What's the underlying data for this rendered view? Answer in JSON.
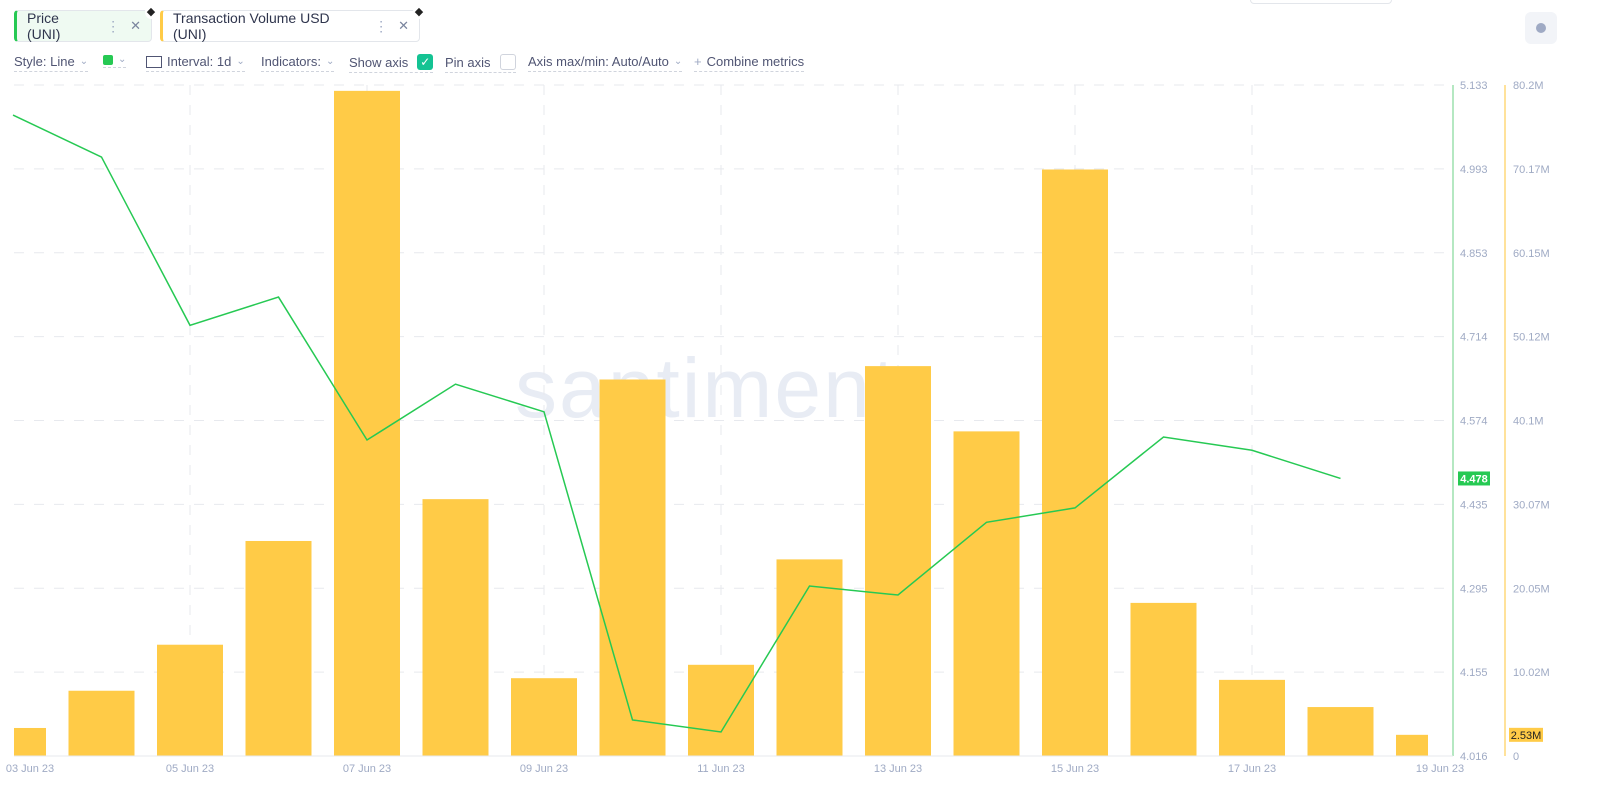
{
  "tabs": [
    {
      "label": "Price (UNI)",
      "color": "#26c953",
      "bg": "#effaf2"
    },
    {
      "label": "Transaction Volume USD (UNI)",
      "color": "#ffcb47",
      "bg": "#ffffff"
    }
  ],
  "toolbar": {
    "style": "Style: Line",
    "color": "#26c953",
    "interval": "Interval: 1d",
    "indicators": "Indicators:",
    "show_axis": "Show axis",
    "show_axis_checked": true,
    "pin_axis": "Pin axis",
    "pin_axis_checked": false,
    "axis_maxmin": "Axis max/min: Auto/Auto",
    "combine": "Combine metrics"
  },
  "watermark": "santiment.",
  "chart_data": {
    "type": "bar+line",
    "x": [
      "03 Jun 23",
      "04 Jun 23",
      "05 Jun 23",
      "06 Jun 23",
      "07 Jun 23",
      "08 Jun 23",
      "09 Jun 23",
      "10 Jun 23",
      "11 Jun 23",
      "12 Jun 23",
      "13 Jun 23",
      "14 Jun 23",
      "15 Jun 23",
      "16 Jun 23",
      "17 Jun 23",
      "18 Jun 23",
      "19 Jun 23"
    ],
    "x_tick_labels": [
      "03 Jun 23",
      "05 Jun 23",
      "07 Jun 23",
      "09 Jun 23",
      "11 Jun 23",
      "13 Jun 23",
      "15 Jun 23",
      "17 Jun 23",
      "19 Jun 23"
    ],
    "series": [
      {
        "name": "Transaction Volume USD (UNI)",
        "type": "bar",
        "color": "#ffcb47",
        "unit": "USD",
        "values": [
          3350000.0,
          7800000.0,
          13300000.0,
          25700000.0,
          79500000.0,
          30700000.0,
          9300000.0,
          45000000.0,
          10900000.0,
          23500000.0,
          46600000.0,
          38800000.0,
          70100000.0,
          18300000.0,
          9100000.0,
          5850000.0,
          2530000.0
        ],
        "last_label": "2.53M",
        "ylim": [
          0,
          80200000.0
        ],
        "ticks": [
          "0",
          "10.02M",
          "20.05M",
          "30.07M",
          "40.1M",
          "50.12M",
          "60.15M",
          "70.17M",
          "80.2M"
        ]
      },
      {
        "name": "Price (UNI)",
        "type": "line",
        "color": "#26c953",
        "values": [
          5.083,
          5.013,
          4.733,
          4.78,
          4.542,
          4.635,
          4.589,
          4.076,
          4.056,
          4.299,
          4.284,
          4.405,
          4.429,
          4.547,
          4.525,
          4.478
        ],
        "last_label": "4.478",
        "ylim": [
          4.016,
          5.133
        ],
        "ticks": [
          "4.016",
          "4.155",
          "4.295",
          "4.435",
          "4.574",
          "4.714",
          "4.853",
          "4.993",
          "5.133"
        ]
      }
    ]
  }
}
